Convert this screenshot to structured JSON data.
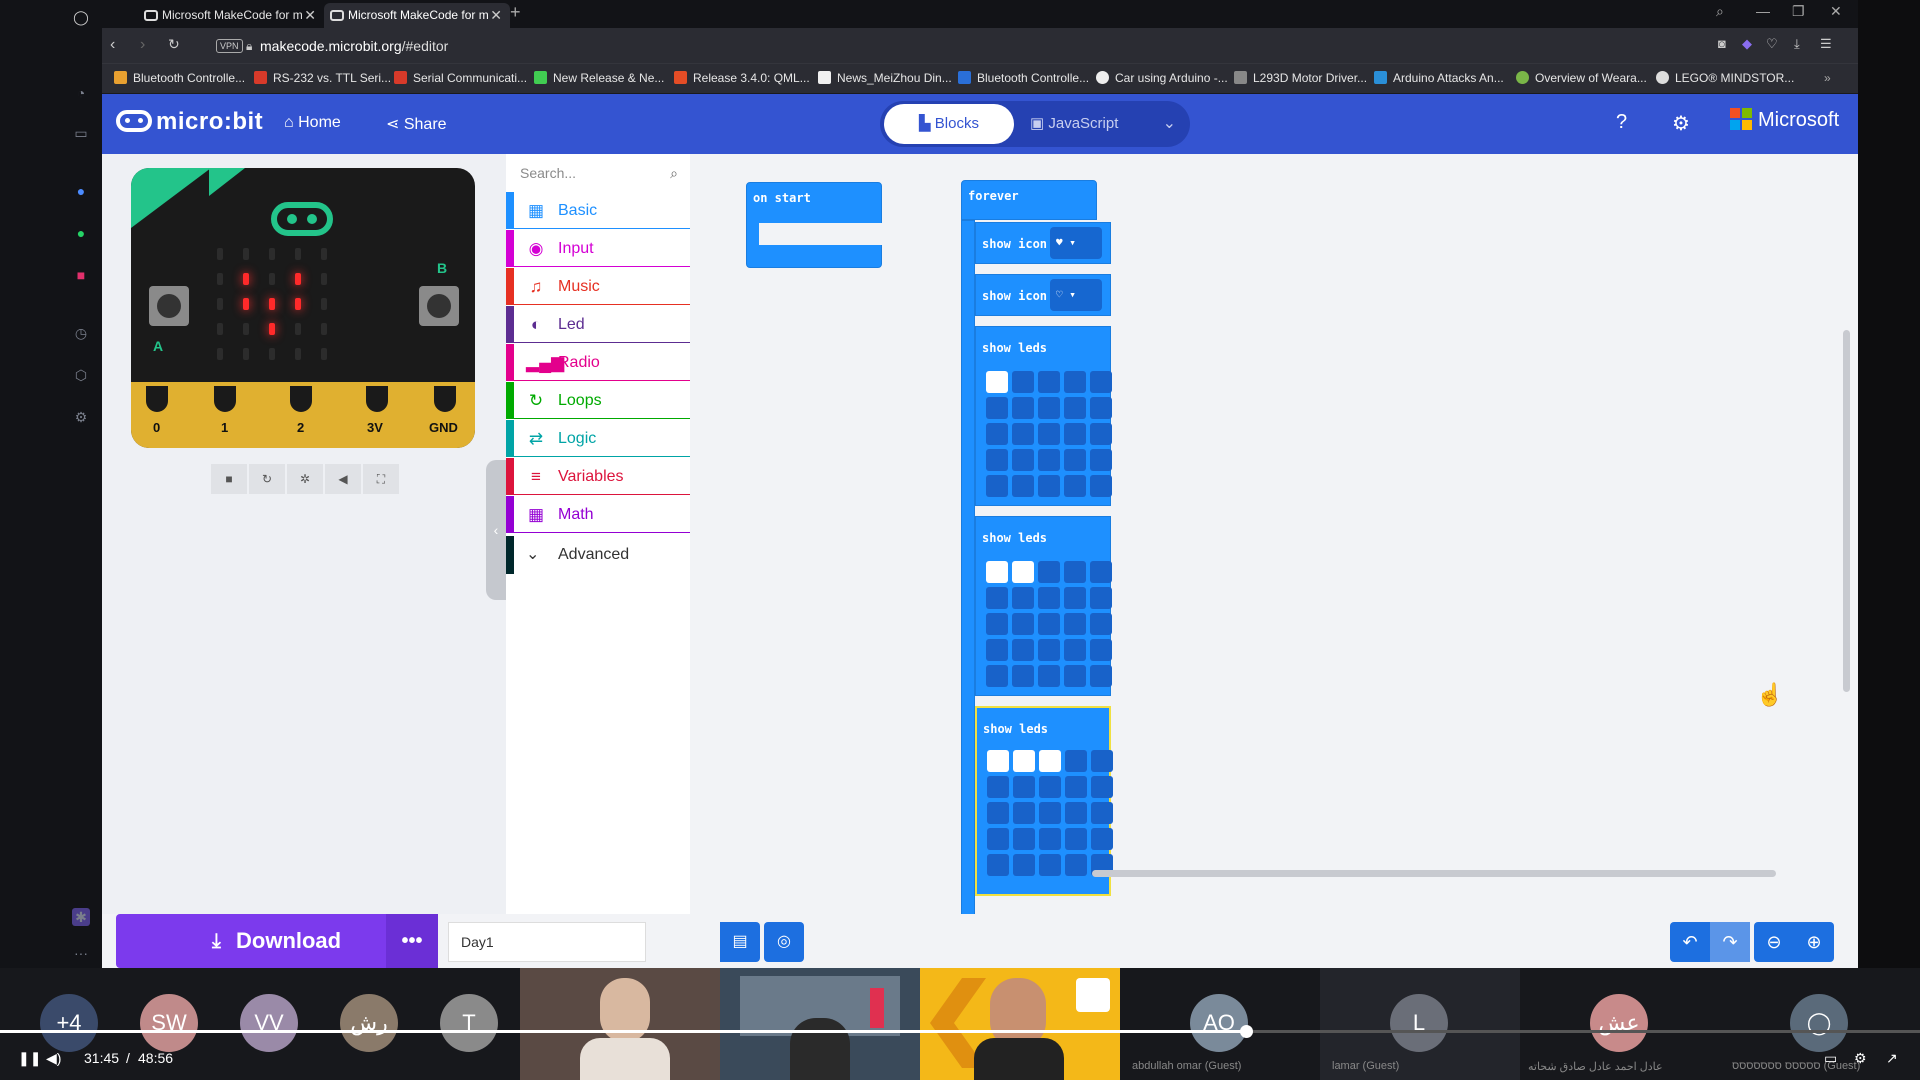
{
  "browser": {
    "tabs": [
      {
        "title": "Microsoft MakeCode for m"
      },
      {
        "title": "Microsoft MakeCode for m"
      }
    ],
    "new_tab": "+",
    "url": {
      "host": "makecode.microbit.org",
      "path": "/#editor",
      "vpn_label": "VPN"
    },
    "bookmarks": [
      {
        "label": "Bluetooth Controlle...",
        "color": "#e8a030"
      },
      {
        "label": "RS-232 vs. TTL Seri...",
        "color": "#d83a2a"
      },
      {
        "label": "Serial Communicati...",
        "color": "#d83a2a"
      },
      {
        "label": "New Release & Ne...",
        "color": "#41cd52"
      },
      {
        "label": "Release 3.4.0: QML...",
        "color": "#e44d26"
      },
      {
        "label": "News_MeiZhou Din...",
        "color": "#f0f0f0"
      },
      {
        "label": "Bluetooth Controlle...",
        "color": "#2a6fd8"
      },
      {
        "label": "Car using Arduino -...",
        "color": "#eeeeee"
      },
      {
        "label": "L293D Motor Driver...",
        "color": "#888888"
      },
      {
        "label": "Arduino Attacks An...",
        "color": "#2a8fd8"
      },
      {
        "label": "Overview of Weara...",
        "color": "#7ab648"
      },
      {
        "label": "LEGO® MINDSTOR...",
        "color": "#dddddd"
      }
    ]
  },
  "header": {
    "logo": "micro:bit",
    "home": "Home",
    "share": "Share",
    "blocks_tab": "Blocks",
    "javascript_tab": "JavaScript",
    "microsoft": "Microsoft",
    "colors": {
      "header_bg": "#3454d1",
      "accent": "#1e90ff"
    }
  },
  "simulator": {
    "pins": [
      "0",
      "1",
      "2",
      "3V",
      "GND"
    ],
    "buttons": {
      "a": "A",
      "b": "B"
    },
    "leds_on": [
      [
        1,
        1
      ],
      [
        1,
        3
      ],
      [
        2,
        1
      ],
      [
        2,
        2
      ],
      [
        2,
        3
      ],
      [
        3,
        2
      ]
    ],
    "controls": [
      "stop-icon",
      "restart-icon",
      "debug-icon",
      "mute-icon",
      "fullscreen-icon"
    ]
  },
  "toolbox": {
    "search_placeholder": "Search...",
    "categories": [
      {
        "label": "Basic",
        "color": "#1e90ff",
        "icon": "grid-icon"
      },
      {
        "label": "Input",
        "color": "#d400d4",
        "icon": "target-icon"
      },
      {
        "label": "Music",
        "color": "#e63022",
        "icon": "headphones-icon"
      },
      {
        "label": "Led",
        "color": "#5c2d91",
        "icon": "toggle-icon"
      },
      {
        "label": "Radio",
        "color": "#e3008c",
        "icon": "signal-icon"
      },
      {
        "label": "Loops",
        "color": "#00aa00",
        "icon": "loop-icon"
      },
      {
        "label": "Logic",
        "color": "#00a4a6",
        "icon": "shuffle-icon"
      },
      {
        "label": "Variables",
        "color": "#dc143c",
        "icon": "list-icon"
      },
      {
        "label": "Math",
        "color": "#9400d3",
        "icon": "calculator-icon"
      }
    ],
    "advanced": "Advanced"
  },
  "workspace": {
    "on_start": "on start",
    "forever": "forever",
    "show_icon": "show icon",
    "show_leds": "show leds",
    "led_patterns": [
      [
        [
          1,
          0,
          0,
          0,
          0
        ],
        [
          0,
          0,
          0,
          0,
          0
        ],
        [
          0,
          0,
          0,
          0,
          0
        ],
        [
          0,
          0,
          0,
          0,
          0
        ],
        [
          0,
          0,
          0,
          0,
          0
        ]
      ],
      [
        [
          1,
          1,
          0,
          0,
          0
        ],
        [
          0,
          0,
          0,
          0,
          0
        ],
        [
          0,
          0,
          0,
          0,
          0
        ],
        [
          0,
          0,
          0,
          0,
          0
        ],
        [
          0,
          0,
          0,
          0,
          0
        ]
      ],
      [
        [
          1,
          1,
          1,
          0,
          0
        ],
        [
          0,
          0,
          0,
          0,
          0
        ],
        [
          0,
          0,
          0,
          0,
          0
        ],
        [
          0,
          0,
          0,
          0,
          0
        ],
        [
          0,
          0,
          0,
          0,
          0
        ]
      ]
    ]
  },
  "footer": {
    "download": "Download",
    "more": "•••",
    "project_name": "Day1"
  },
  "meeting": {
    "participants": [
      {
        "initials": "+4",
        "color": "#3a4a6a"
      },
      {
        "initials": "SW",
        "color": "#c08a8a"
      },
      {
        "initials": "VV",
        "color": "#9a8aa8"
      },
      {
        "initials": "رش",
        "color": "#8a7a6a"
      },
      {
        "initials": "T",
        "color": "#8a8a8a"
      }
    ],
    "right_participants": [
      {
        "initials": "AO",
        "name": "abdullah omar (Guest)",
        "color": "#7a8a9a"
      },
      {
        "initials": "L",
        "name": "lamar (Guest)",
        "color": "#6a6e78"
      },
      {
        "initials": "عش",
        "name": "عادل احمد عادل صادق شحاته",
        "color": "#c88a8a"
      },
      {
        "initials": "",
        "name": "ססססס ססססססס (Guest)",
        "color": "#5a6a7a"
      }
    ]
  },
  "player": {
    "current": "31:45",
    "separator": "/",
    "total": "48:56",
    "progress": 0.649
  }
}
